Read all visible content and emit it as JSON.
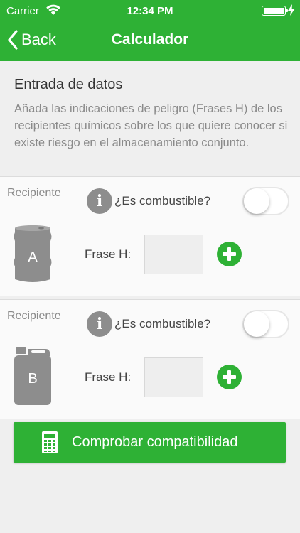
{
  "status_bar": {
    "carrier": "Carrier",
    "time": "12:34 PM",
    "wifi_icon": "wifi-icon",
    "battery_icon": "battery-icon",
    "charging_icon": "bolt-icon"
  },
  "nav": {
    "back_label": "Back",
    "title": "Calculador"
  },
  "intro": {
    "title": "Entrada de datos",
    "description": "Añada las indicaciones de peligro (Frases H) de los recipientes químicos sobre los que quiere conocer si existe riesgo en el almacenamiento conjunto."
  },
  "containers": [
    {
      "label": "Recipiente",
      "letter": "A",
      "icon": "barrel-icon",
      "question": "¿Es combustible?",
      "combustible": false,
      "frase_label": "Frase H:",
      "frase_value": ""
    },
    {
      "label": "Recipiente",
      "letter": "B",
      "icon": "jerrycan-icon",
      "question": "¿Es combustible?",
      "combustible": false,
      "frase_label": "Frase H:",
      "frase_value": ""
    }
  ],
  "action": {
    "label": "Comprobar compatibilidad",
    "icon": "calculator-icon"
  },
  "colors": {
    "primary": "#2eb135",
    "icon_gray": "#8d8d8d",
    "background": "#efefef"
  }
}
